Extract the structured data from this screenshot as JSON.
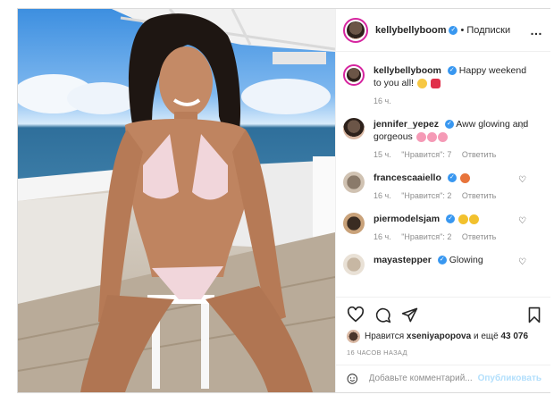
{
  "post": {
    "author": "kellybellyboom",
    "follow_separator": "•",
    "follow_label": "Подписки",
    "more_icon": "…"
  },
  "caption": {
    "author": "kellybellyboom",
    "text": "Happy weekend to you all!",
    "time": "16 ч."
  },
  "comments": [
    {
      "author": "jennifer_yepez",
      "text": "Aww glowing and gorgeous",
      "time": "15 ч.",
      "likes": "\"Нравится\": 7",
      "reply": "Ответить"
    },
    {
      "author": "francescaaiello",
      "text": "",
      "time": "16 ч.",
      "likes": "\"Нравится\": 2",
      "reply": "Ответить"
    },
    {
      "author": "piermodelsjam",
      "text": "",
      "time": "16 ч.",
      "likes": "\"Нравится\": 2",
      "reply": "Ответить"
    },
    {
      "author": "mayastepper",
      "text": "Glowing",
      "time": "",
      "likes": "",
      "reply": ""
    }
  ],
  "likes_line": {
    "prefix": "Нравится",
    "user": "xseniyapopova",
    "middle": "и ещё",
    "count": "43 076"
  },
  "timestamp": "16 ЧАСОВ НАЗАД",
  "add_comment": {
    "placeholder": "Добавьте комментарий...",
    "post_label": "Опубликовать"
  },
  "colors": {
    "verified": "#3897f0",
    "post_button_disabled": "#b2dffc",
    "story_ring": "#d6249f"
  }
}
